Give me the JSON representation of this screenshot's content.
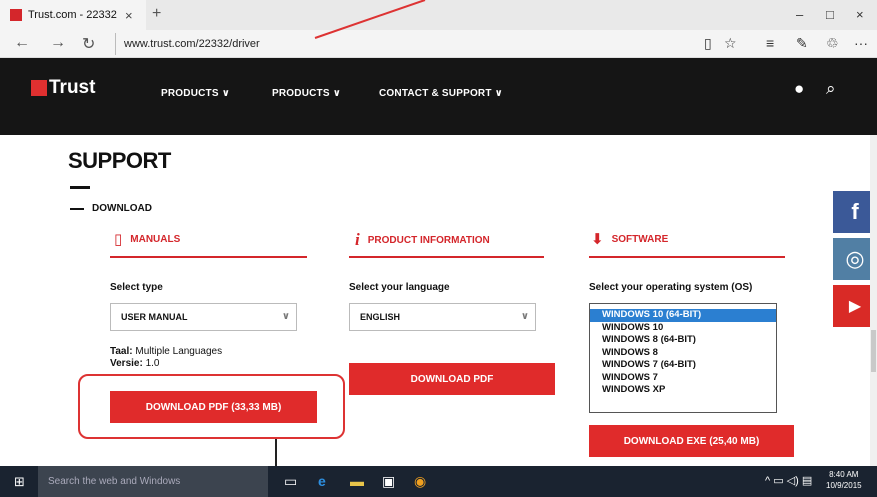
{
  "browser": {
    "tab_title": "Trust.com - 22332",
    "tab_close": "×",
    "new_tab": "+",
    "url": "www.trust.com/22332/driver",
    "nav_back": "←",
    "nav_forward": "→",
    "nav_refresh": "↻",
    "win_min": "–",
    "win_max": "□",
    "win_close": "×",
    "tool_reading": "▯",
    "tool_fav": "☆",
    "tool_hub": "≡",
    "tool_note": "✎",
    "tool_share": "♲",
    "tool_more": "···"
  },
  "header": {
    "logo_text": "Trust",
    "nav": [
      {
        "label": "PRODUCTS ∨"
      },
      {
        "label": "PRODUCTS ∨"
      },
      {
        "label": "CONTACT & SUPPORT ∨"
      }
    ],
    "user_icon": "●",
    "search_icon": "⌕"
  },
  "page": {
    "title": "SUPPORT",
    "section": "DOWNLOAD"
  },
  "columns": {
    "manuals": {
      "heading": "MANUALS",
      "icon": "▯",
      "select_label": "Select type",
      "select_value": "USER MANUAL",
      "meta_taal_key": "Taal:",
      "meta_taal_val": "Multiple Languages",
      "meta_versie_key": "Versie:",
      "meta_versie_val": "1.0",
      "button": "DOWNLOAD PDF (33,33 MB)"
    },
    "product_info": {
      "heading": "PRODUCT INFORMATION",
      "icon": "i",
      "select_label": "Select your language",
      "select_value": "ENGLISH",
      "button": "DOWNLOAD PDF"
    },
    "software": {
      "heading": "SOFTWARE",
      "icon": "⬇",
      "select_label": "Select your operating system (OS)",
      "options": [
        "WINDOWS 10 (64-BIT)",
        "WINDOWS 10",
        "WINDOWS 8 (64-BIT)",
        "WINDOWS 8",
        "WINDOWS 7 (64-BIT)",
        "WINDOWS 7",
        "WINDOWS XP"
      ],
      "selected_index": 0,
      "button": "DOWNLOAD EXE (25,40 MB)"
    }
  },
  "social": {
    "facebook": "f",
    "instagram": "◎",
    "youtube": "▶"
  },
  "colors": {
    "accent": "#e02b2b",
    "facebook": "#3b5998",
    "instagram": "#517fa4",
    "youtube": "#d92a26"
  },
  "taskbar": {
    "search_placeholder": "Search the web and Windows",
    "time": "8:40 AM",
    "date": "10/9/2015",
    "tray_icons": "^ ▭ ◁) ▤"
  }
}
